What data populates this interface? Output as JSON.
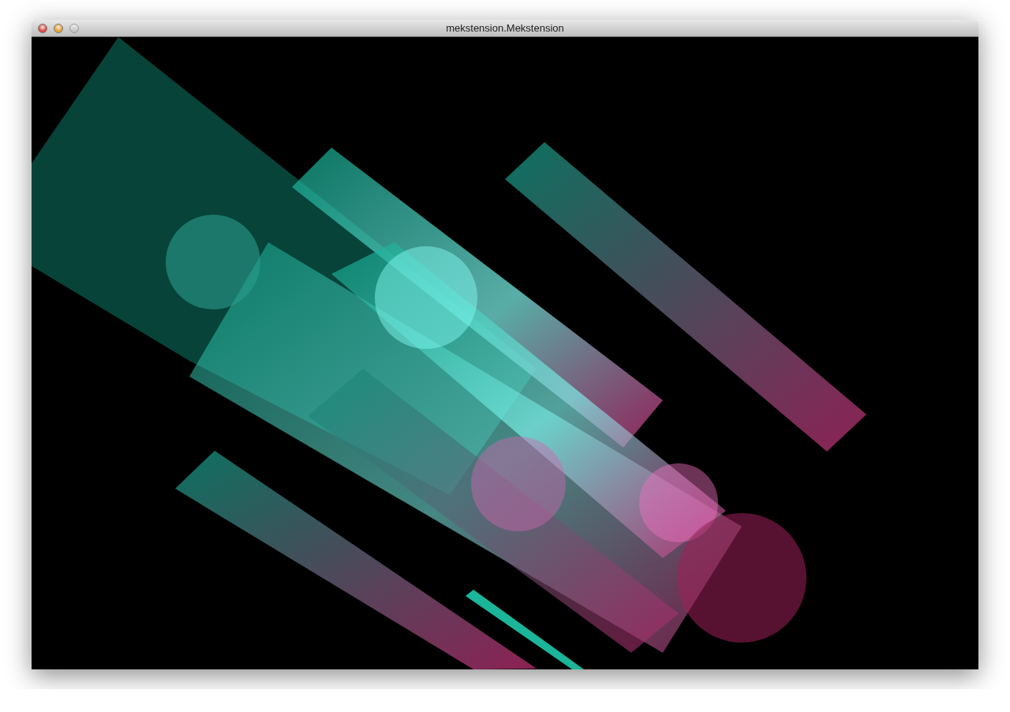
{
  "window": {
    "title": "mekstension.Mekstension",
    "controls": [
      {
        "kind": "close",
        "disabled": false
      },
      {
        "kind": "minimize",
        "disabled": false
      },
      {
        "kind": "zoom",
        "disabled": true
      }
    ]
  }
}
